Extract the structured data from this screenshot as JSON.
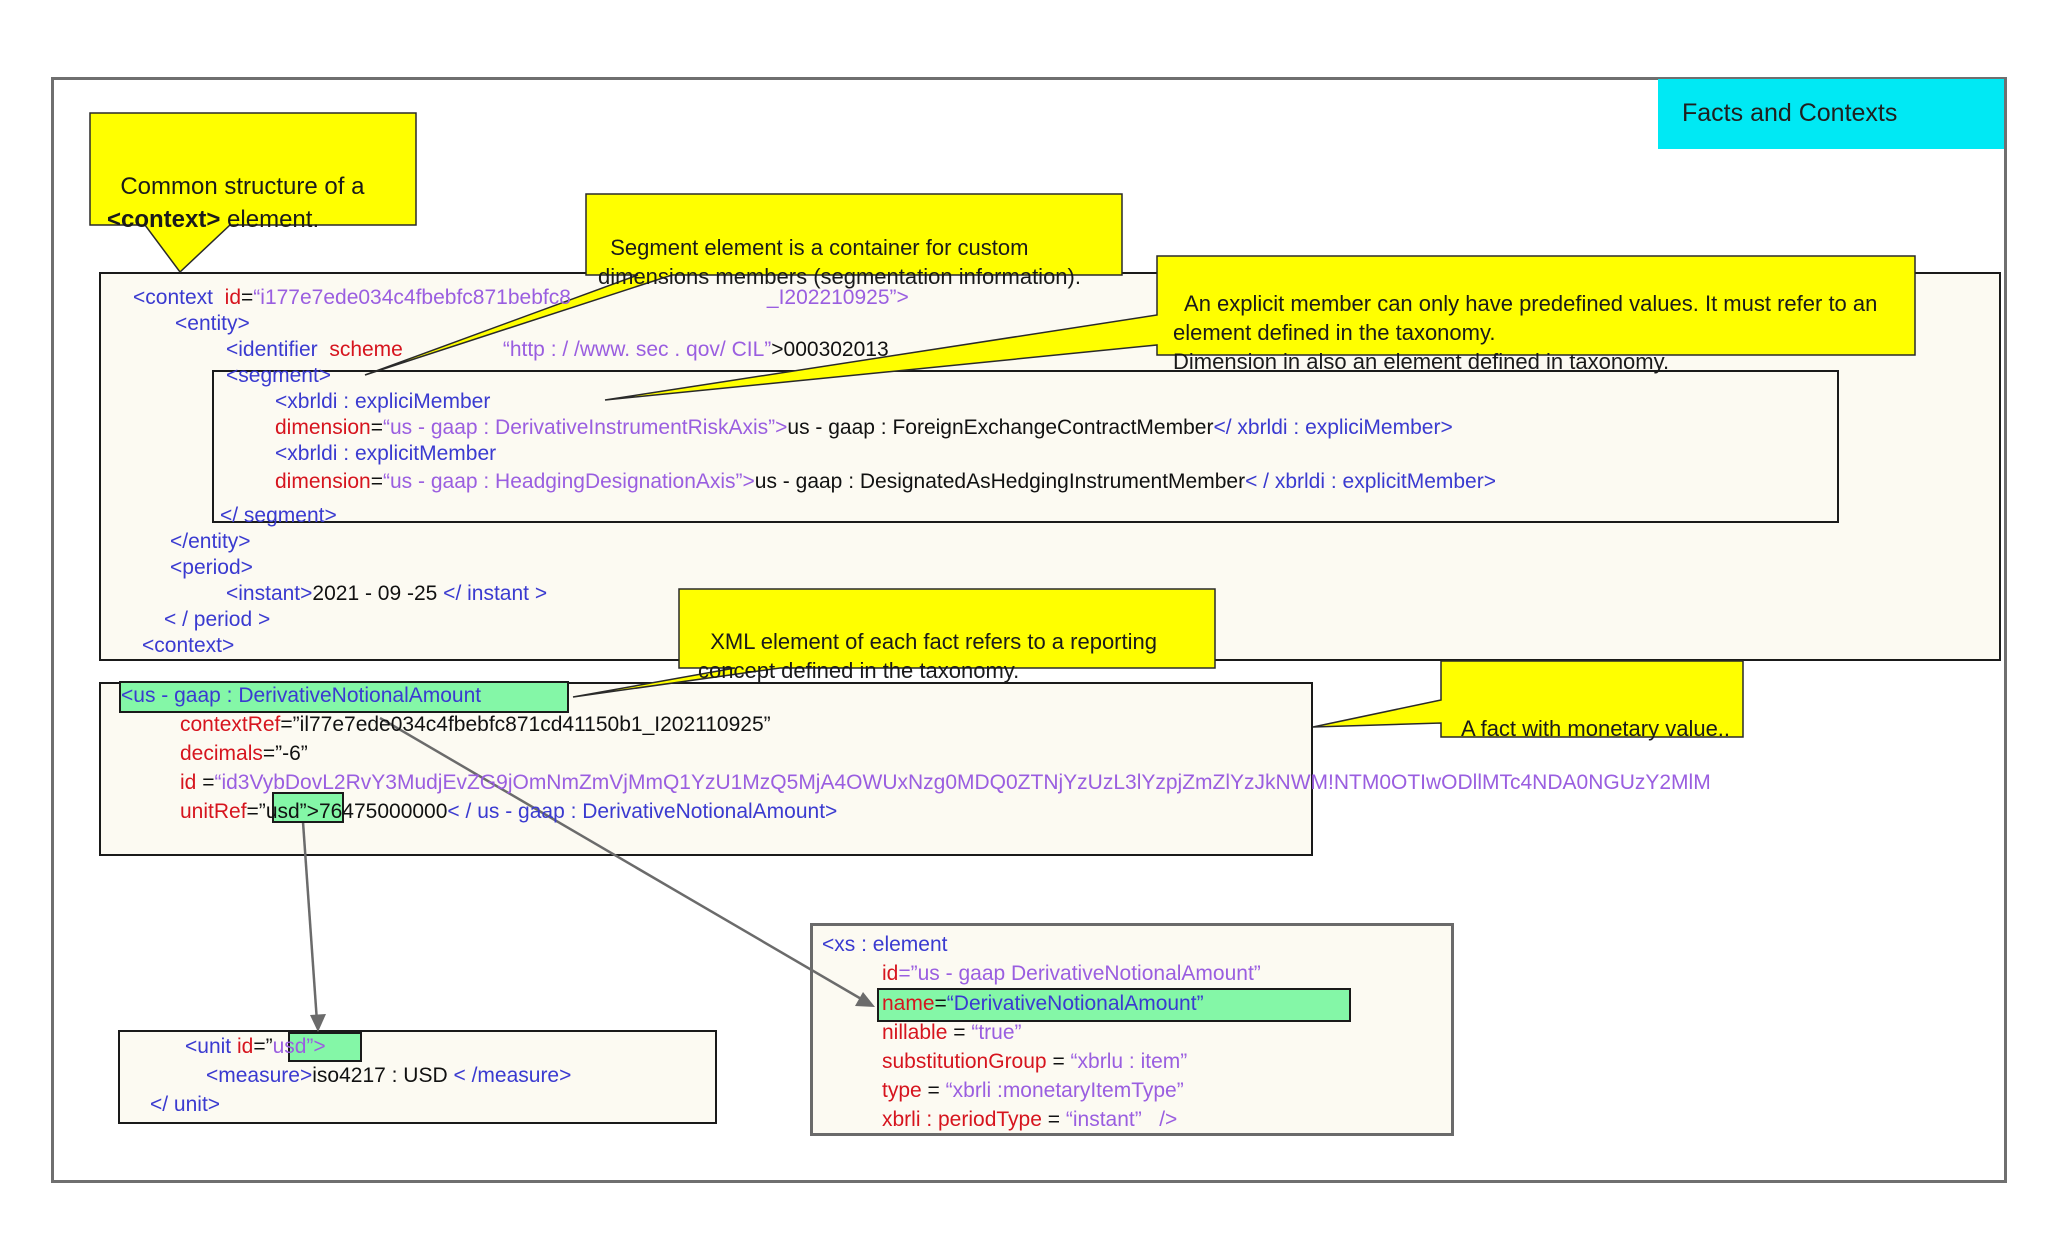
{
  "title": "Facts and Contexts",
  "callouts": {
    "context_structure": {
      "line1": "Common structure of a",
      "bold": "<context>",
      "rest": " element."
    },
    "segment": {
      "line1": "Segment element is a container for custom",
      "line2": "dimensions members (segmentation information)."
    },
    "explicit": {
      "line1": "An explicit member can only have predefined values. It must refer to an",
      "line2": "element defined in the taxonomy.",
      "line3": "Dimension in also an element defined in taxonomy."
    },
    "xml_element": {
      "line1": "XML element of each fact refers to a reporting",
      "line2": "concept defined in the taxonomy."
    },
    "monetary": {
      "line1": "A fact with monetary value.."
    }
  },
  "context_block": {
    "l1_tag": "<context",
    "l1_attr": "id",
    "l1_eq": "=",
    "l1_val_a": "“i177e7ede034c4fbebfc871bebfc8",
    "l1_val_b": "_I202210925”>",
    "l2": "<entity>",
    "l3_tag": "<identifier",
    "l3_attr": "scheme",
    "l3_val": "“http : / /www. sec . qov/ CIL”",
    "l3_text": ">000302013",
    "l4": "<segment>",
    "l5": "<xbrldi : expliciMember",
    "l6_attr": "dimension",
    "l6_eq": "=",
    "l6_val": "“us - gaap : DerivativeInstrumentRiskAxis”>",
    "l6_text": "us - gaap : ForeignExchangeContractMember",
    "l6_close": "</ xbrldi : expliciMember>",
    "l7": "<xbrldi : explicitMember",
    "l8_attr": "dimension",
    "l8_eq": "=",
    "l8_val": "“us - gaap : HeadgingDesignationAxis”>",
    "l8_text": "us - gaap : DesignatedAsHedgingInstrumentMember",
    "l8_close": "< / xbrldi : explicitMember>",
    "l9": "</ segment>",
    "l10": "</entity>",
    "l11": "<period>",
    "l12_tag": "<instant>",
    "l12_text": "2021 - 09 -25",
    "l12_close": " </ instant >",
    "l13": "< / period >",
    "l14": "<context>"
  },
  "fact_block": {
    "l1": "<us - gaap : DerivativeNotionalAmount",
    "l2_attr": "contextRef",
    "l2_val": "=”il77e7ede034c4fbebfc871cd41150b1_I202110925”",
    "l3_attr": "decimals",
    "l3_val": "=”-6”",
    "l4_attr": "id",
    "l4_eq": " =",
    "l4_val": "“id3VybDovL2RvY3MudjEvZG9jOmNmZmVjMmQ1YzU1MzQ5MjA4OWUxNzg0MDQ0ZTNjYzUzL3lYzpjZmZlYzJkNWM!NTM0OTIwODllMTc4NDA0NGUzY2MlM",
    "l5_attr": "unitRef",
    "l5_eq": "=”",
    "l5_hl": "usd”>",
    "l5_text": "76475000000",
    "l5_close": "< / us - gaap : DerivativeNotionalAmount>"
  },
  "unit_block": {
    "l1_tag": "<unit",
    "l1_attr": " id",
    "l1_eq": "=”",
    "l1_hl": "usd”>",
    "l2_tag": "<measure>",
    "l2_text": "iso4217 : USD",
    "l2_close": " < /measure>",
    "l3": "</ unit>"
  },
  "element_block": {
    "l1": "<xs : element",
    "l2_attr": "id",
    "l2_val": "=”us - gaap DerivativeNotionalAmount”",
    "l3_attr": "name",
    "l3_eq": "=",
    "l3_val": "“DerivativeNotionalAmount”",
    "l4_attr": "nillable",
    "l4_eq": " =",
    "l4_val": " “true”",
    "l5_attr": "substitutionGroup",
    "l5_eq": " =",
    "l5_val": " “xbrlu : item”",
    "l6_attr": "type",
    "l6_eq": " =",
    "l6_val": " “xbrli :monetaryItemType”",
    "l7_attr": "xbrli : periodType",
    "l7_eq": " =",
    "l7_val": " “instant”   />"
  },
  "colors": {
    "callout": "#ffff00",
    "title_bg": "#00e9f4",
    "highlight": "#84f7a7",
    "tag": "#3a3ad0",
    "attr": "#d6141e",
    "value": "#9a5ee0"
  }
}
